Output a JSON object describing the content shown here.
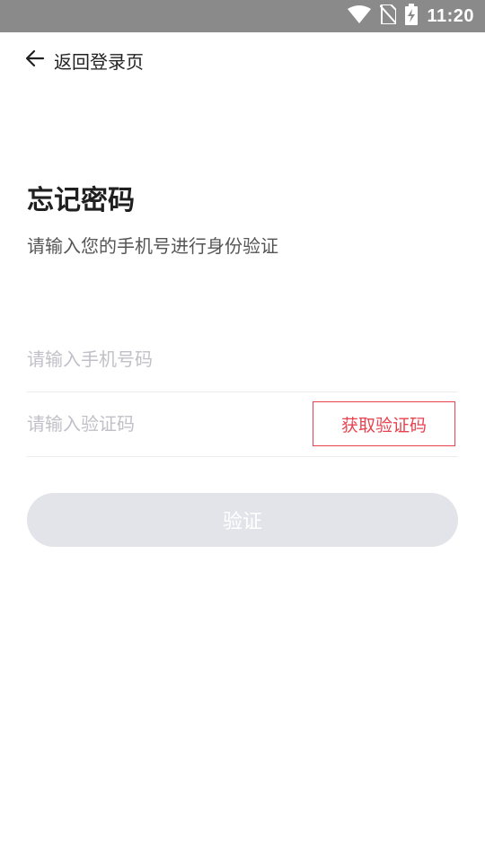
{
  "status_bar": {
    "time": "11:20",
    "icons": [
      "wifi-icon",
      "no-sim-icon",
      "battery-charging-icon"
    ]
  },
  "nav": {
    "back_label": "返回登录页",
    "back_icon": "arrow-left-icon"
  },
  "page": {
    "title": "忘记密码",
    "subtitle": "请输入您的手机号进行身份验证"
  },
  "form": {
    "phone": {
      "placeholder": "请输入手机号码",
      "value": ""
    },
    "code": {
      "placeholder": "请输入验证码",
      "value": ""
    },
    "get_code_label": "获取验证码",
    "submit_label": "验证"
  },
  "colors": {
    "accent": "#e8424e",
    "disabled_button": "#e3e4e9",
    "status_bar": "#8a8a8a"
  }
}
